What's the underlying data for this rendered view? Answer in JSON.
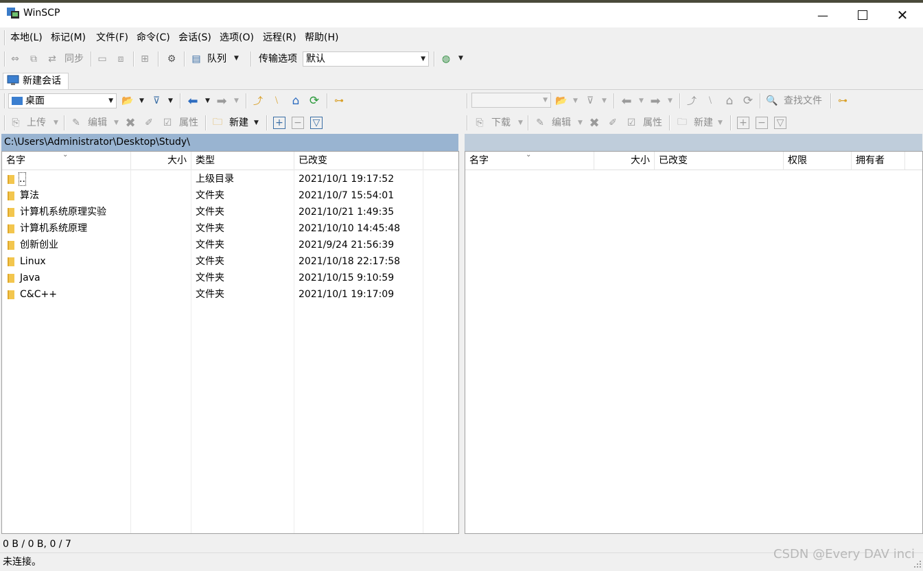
{
  "window": {
    "title": "WinSCP"
  },
  "menu": [
    "本地(L)",
    "标记(M)",
    "文件(F)",
    "命令(C)",
    "会话(S)",
    "选项(O)",
    "远程(R)",
    "帮助(H)"
  ],
  "toolbar_main": {
    "sync_label": "同步",
    "queue_label": "队列",
    "transfer_options_label": "传输选项",
    "transfer_options_value": "默认"
  },
  "tabs": {
    "new_session": "新建会话"
  },
  "local": {
    "location": "桌面",
    "actions": {
      "upload": "上传",
      "edit": "编辑",
      "properties": "属性",
      "new": "新建"
    },
    "path": "C:\\Users\\Administrator\\Desktop\\Study\\",
    "columns": {
      "name": "名字",
      "size": "大小",
      "type": "类型",
      "modified": "已改变"
    },
    "files": [
      {
        "name": "..",
        "type": "上级目录",
        "modified": "2021/10/1  19:17:52",
        "icon": "parent-dir-icon"
      },
      {
        "name": "算法",
        "type": "文件夹",
        "modified": "2021/10/7  15:54:01",
        "icon": "folder-icon"
      },
      {
        "name": "计算机系统原理实验",
        "type": "文件夹",
        "modified": "2021/10/21  1:49:35",
        "icon": "folder-icon"
      },
      {
        "name": "计算机系统原理",
        "type": "文件夹",
        "modified": "2021/10/10  14:45:48",
        "icon": "folder-icon"
      },
      {
        "name": "创新创业",
        "type": "文件夹",
        "modified": "2021/9/24  21:56:39",
        "icon": "folder-icon"
      },
      {
        "name": "Linux",
        "type": "文件夹",
        "modified": "2021/10/18  22:17:58",
        "icon": "folder-icon"
      },
      {
        "name": "Java",
        "type": "文件夹",
        "modified": "2021/10/15  9:10:59",
        "icon": "folder-icon"
      },
      {
        "name": "C&C++",
        "type": "文件夹",
        "modified": "2021/10/1  19:17:09",
        "icon": "folder-icon"
      }
    ]
  },
  "remote": {
    "find_files_label": "查找文件",
    "actions": {
      "download": "下载",
      "edit": "编辑",
      "properties": "属性",
      "new": "新建"
    },
    "columns": {
      "name": "名字",
      "size": "大小",
      "modified": "已改变",
      "rights": "权限",
      "owner": "拥有者"
    }
  },
  "status": {
    "counts": "0 B / 0 B,  0 / 7",
    "connection": "未连接。"
  },
  "watermark": "CSDN @Every DAV inci",
  "colors": {
    "path_bar_active": "#99b4d1",
    "path_bar_inactive": "#bfcddb",
    "folder": "#f3c64e"
  }
}
